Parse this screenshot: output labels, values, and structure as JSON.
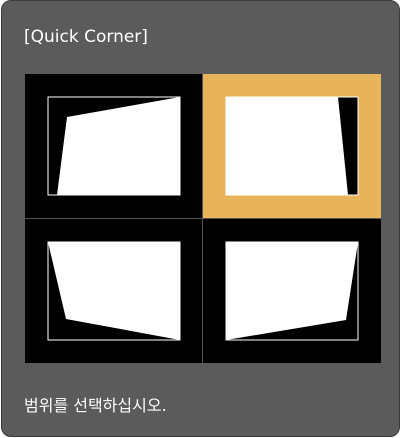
{
  "dialog": {
    "title": "[Quick Corner]",
    "prompt": "범위를 선택하십시오."
  },
  "options": [
    {
      "corner": "top-left",
      "selected": false
    },
    {
      "corner": "top-right",
      "selected": true
    },
    {
      "corner": "bottom-left",
      "selected": false
    },
    {
      "corner": "bottom-right",
      "selected": false
    }
  ],
  "colors": {
    "panel_background": "#5b5b5b",
    "grid_background": "#000000",
    "selection_highlight": "#e8b45b",
    "shape_fill": "#ffffff",
    "text": "#ffffff"
  },
  "icons": {
    "corner_option": "keystone-shape-icon"
  }
}
